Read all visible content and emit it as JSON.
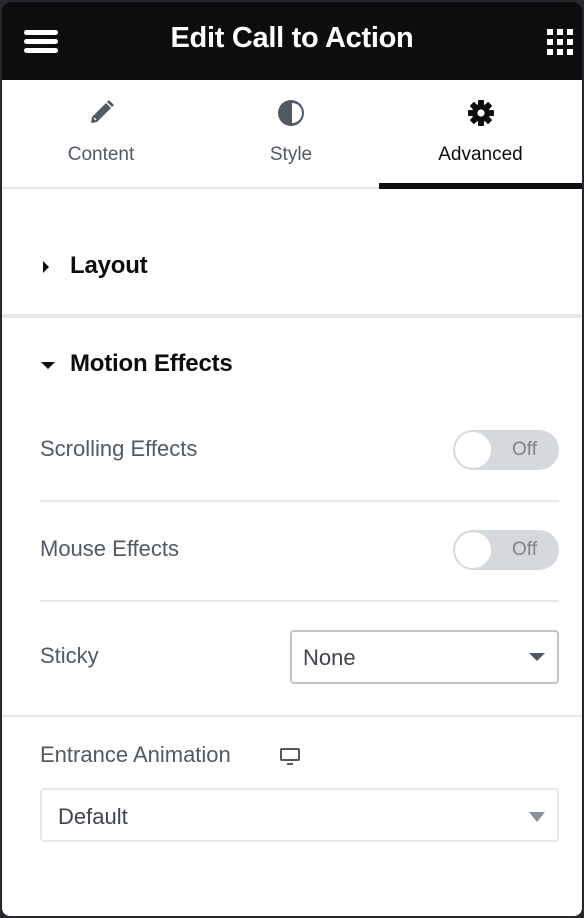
{
  "header": {
    "title": "Edit Call to Action",
    "menu_icon": "hamburger-icon",
    "apps_icon": "grid-icon"
  },
  "tabs": [
    {
      "label": "Content",
      "icon": "pencil-icon",
      "active": false
    },
    {
      "label": "Style",
      "icon": "half-circle-icon",
      "active": false
    },
    {
      "label": "Advanced",
      "icon": "gear-icon",
      "active": true
    }
  ],
  "sections": {
    "layout": {
      "title": "Layout",
      "expanded": false
    },
    "motion": {
      "title": "Motion Effects",
      "expanded": true
    }
  },
  "motion": {
    "scrolling": {
      "label": "Scrolling Effects",
      "state": "Off"
    },
    "mouse": {
      "label": "Mouse Effects",
      "state": "Off"
    },
    "sticky": {
      "label": "Sticky",
      "value": "None"
    },
    "entrance": {
      "label": "Entrance Animation",
      "device_icon": "desktop-icon",
      "value": "Default"
    }
  },
  "colors": {
    "header_bg": "#0c0d0e",
    "label_text": "#515962",
    "toggle_off_bg": "#d5d8dc"
  }
}
